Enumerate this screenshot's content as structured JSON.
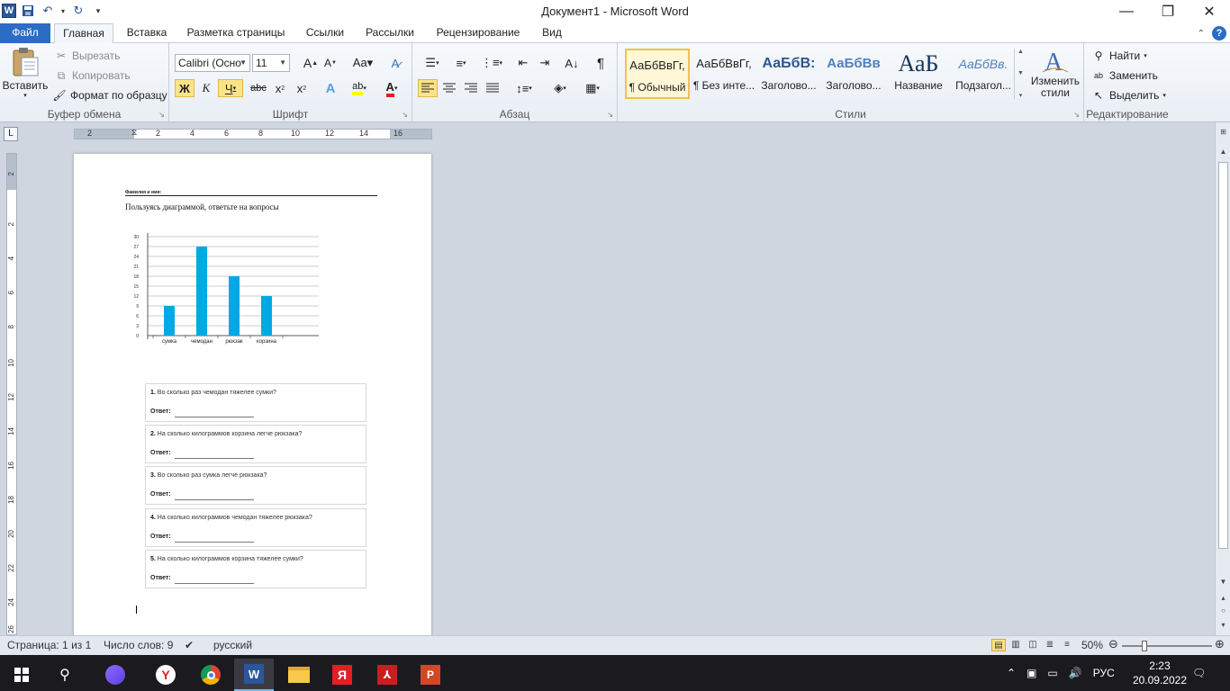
{
  "window": {
    "title": "Документ1  -  Microsoft Word"
  },
  "tabs": [
    "Файл",
    "Главная",
    "Вставка",
    "Разметка страницы",
    "Ссылки",
    "Рассылки",
    "Рецензирование",
    "Вид"
  ],
  "clipboard": {
    "paste": "Вставить",
    "cut": "Вырезать",
    "copy": "Копировать",
    "format_painter": "Формат по образцу",
    "group": "Буфер обмена"
  },
  "font": {
    "name": "Calibri (Осно",
    "size": "11",
    "bold": "Ж",
    "italic": "К",
    "underline": "Ч",
    "strike": "abc",
    "group": "Шрифт"
  },
  "paragraph": {
    "group": "Абзац"
  },
  "styles": {
    "group": "Стили",
    "items": [
      {
        "preview": "АаБбВвГг,",
        "name": "¶ Обычный"
      },
      {
        "preview": "АаБбВвГг,",
        "name": "¶ Без инте..."
      },
      {
        "preview": "АаБбВ:",
        "name": "Заголово..."
      },
      {
        "preview": "АаБбВв",
        "name": "Заголово..."
      },
      {
        "preview": "АаБ",
        "name": "Название"
      },
      {
        "preview": "АаБбВв.",
        "name": "Подзагол..."
      }
    ],
    "change": "Изменить стили"
  },
  "editing": {
    "find": "Найти",
    "replace": "Заменить",
    "select": "Выделить",
    "group": "Редактирование"
  },
  "ruler": {
    "h_ticks": [
      "2",
      "2",
      "4",
      "6",
      "8",
      "10",
      "12",
      "14",
      "16"
    ],
    "v_ticks": [
      "2",
      "2",
      "4",
      "6",
      "8",
      "10",
      "12",
      "14",
      "16",
      "18",
      "20",
      "22",
      "24",
      "26"
    ]
  },
  "document": {
    "name_label": "Фамилия    и имя:",
    "instruction": "Пользуясь диаграммой, ответьте на вопросы",
    "answer_label": "Ответ:",
    "questions": [
      {
        "num": "1.",
        "text": "Во сколько раз чемодан тяжелее сумки?"
      },
      {
        "num": "2.",
        "text": "На сколько килограммов корзина легче рюкзака?"
      },
      {
        "num": "3.",
        "text": "Во сколько раз сумка легче рюкзака?"
      },
      {
        "num": "4.",
        "text": "На сколько килограммов чемодан тяжелее рюкзака?"
      },
      {
        "num": "5.",
        "text": "На сколько килограммов корзина тяжелее сумки?"
      }
    ]
  },
  "chart_data": {
    "type": "bar",
    "categories": [
      "сумка",
      "чемодан",
      "рюкзак",
      "корзина"
    ],
    "values": [
      9,
      27,
      18,
      12
    ],
    "yticks": [
      "0",
      "3",
      "6",
      "9",
      "12",
      "15",
      "18",
      "21",
      "24",
      "27",
      "30"
    ],
    "ylim": [
      0,
      30
    ],
    "grid": true,
    "bar_color": "#00a9e6"
  },
  "status": {
    "page": "Страница: 1 из 1",
    "words": "Число слов: 9",
    "language": "русский",
    "zoom": "50%"
  },
  "taskbar": {
    "lang": "РУС",
    "time": "2:23",
    "date": "20.09.2022"
  }
}
